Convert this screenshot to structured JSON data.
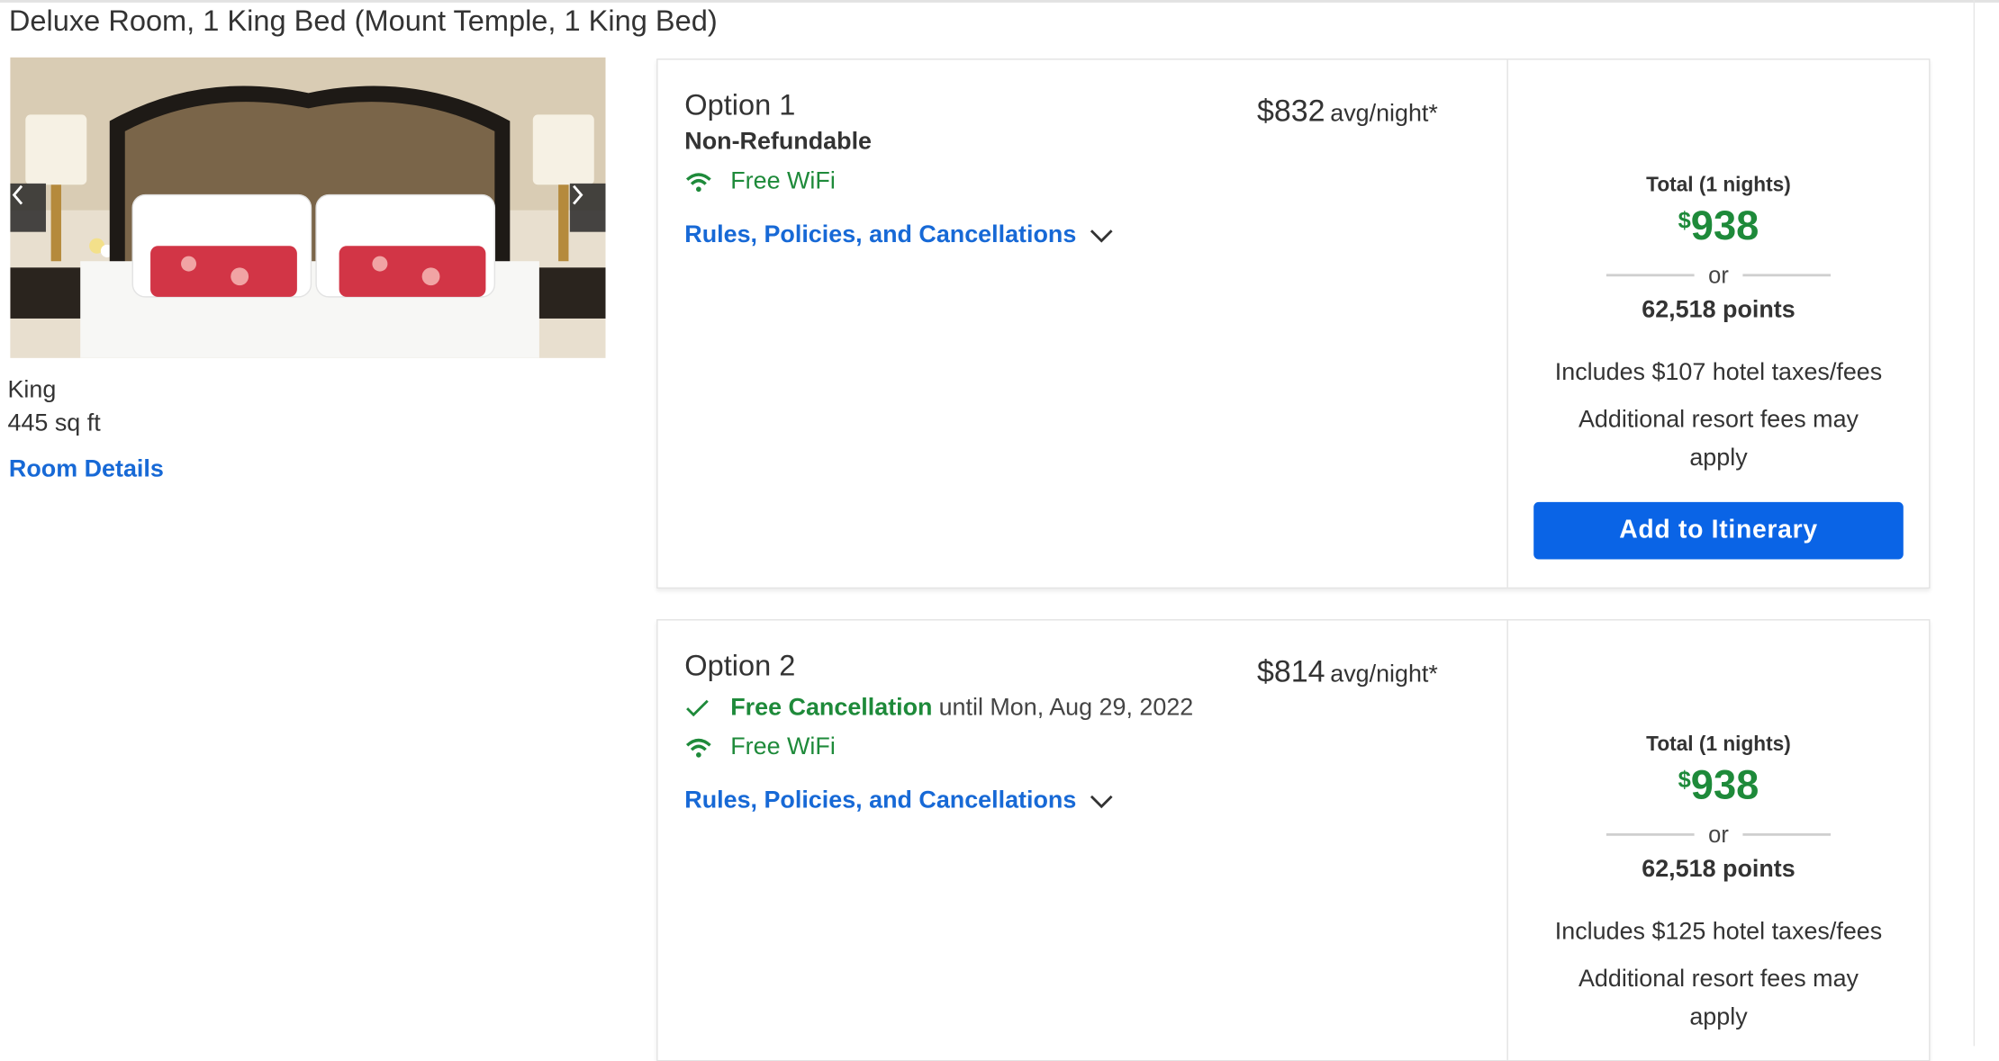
{
  "room": {
    "title": "Deluxe Room, 1 King Bed (Mount Temple, 1 King Bed)",
    "bed_type": "King",
    "size": "445 sq ft",
    "details_link": "Room Details",
    "photo_prev": "‹",
    "photo_next": "›"
  },
  "options": [
    {
      "title": "Option 1",
      "refund_policy": "Non-Refundable",
      "wifi": "Free WiFi",
      "rules_link": "Rules, Policies, and Cancellations",
      "price": "$832",
      "price_unit": "avg/night*",
      "total_label": "Total (1 nights)",
      "total_currency": "$",
      "total_amount": "938",
      "or": "or",
      "points": "62,518 points",
      "taxes": "Includes $107 hotel taxes/fees",
      "resort_fees": "Additional resort fees may apply",
      "add_button": "Add to Itinerary"
    },
    {
      "title": "Option 2",
      "cancellation_label": "Free Cancellation",
      "cancellation_until": "until Mon, Aug 29, 2022",
      "wifi": "Free WiFi",
      "rules_link": "Rules, Policies, and Cancellations",
      "price": "$814",
      "price_unit": "avg/night*",
      "total_label": "Total (1 nights)",
      "total_currency": "$",
      "total_amount": "938",
      "or": "or",
      "points": "62,518 points",
      "taxes": "Includes $125 hotel taxes/fees",
      "resort_fees": "Additional resort fees may apply"
    }
  ],
  "colors": {
    "link_blue": "#1769d6",
    "button_blue": "#0a64e6",
    "success_green": "#1e8a3a"
  },
  "icons": [
    "wifi-icon",
    "checkmark-icon",
    "chevron-down-icon",
    "chevron-left-icon",
    "chevron-right-icon"
  ]
}
